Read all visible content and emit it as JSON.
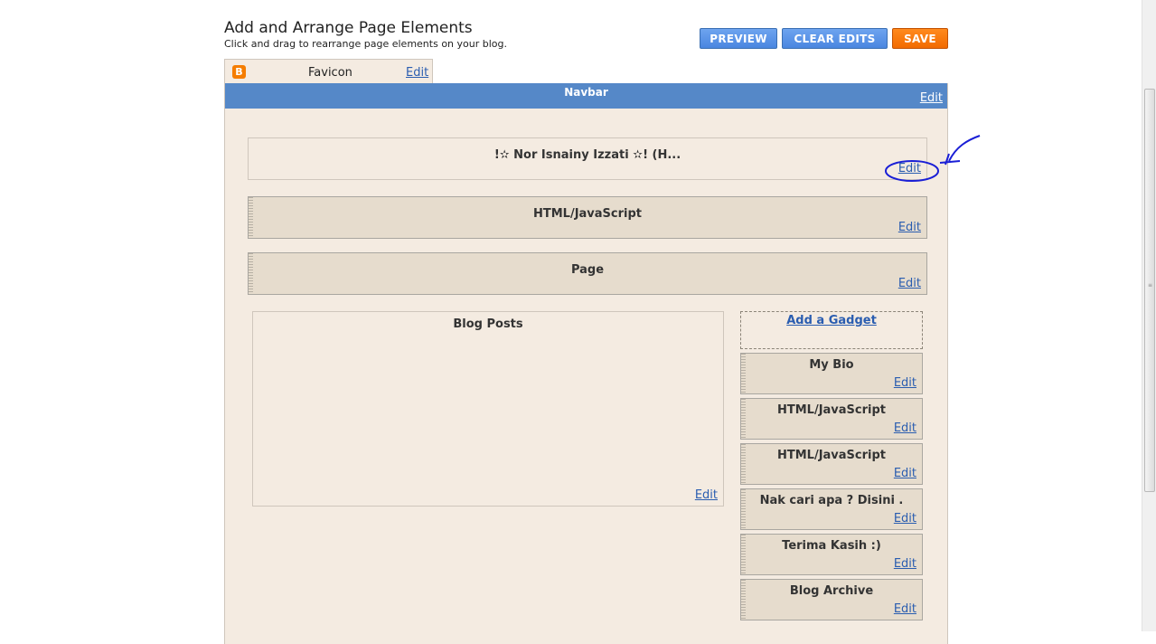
{
  "header": {
    "title": "Add and Arrange Page Elements",
    "subtitle": "Click and drag to rearrange page elements on your blog."
  },
  "toolbar": {
    "preview_label": "PREVIEW",
    "clear_label": "CLEAR EDITS",
    "save_label": "SAVE"
  },
  "favicon": {
    "label": "Favicon",
    "edit": "Edit"
  },
  "navbar": {
    "title": "Navbar",
    "edit": "Edit"
  },
  "header_widget": {
    "title": "!✫ Nor Isnainy Izzati ✫! (H...",
    "edit": "Edit"
  },
  "top_widgets": [
    {
      "title": "HTML/JavaScript",
      "edit": "Edit"
    },
    {
      "title": "Page",
      "edit": "Edit"
    }
  ],
  "main": {
    "title": "Blog Posts",
    "edit": "Edit"
  },
  "sidebar": {
    "add_gadget": "Add a Gadget",
    "items": [
      {
        "title": "My Bio",
        "edit": "Edit"
      },
      {
        "title": "HTML/JavaScript",
        "edit": "Edit"
      },
      {
        "title": "HTML/JavaScript",
        "edit": "Edit"
      },
      {
        "title": "Nak cari apa ? Disini .",
        "edit": "Edit"
      },
      {
        "title": "Terima Kasih :)",
        "edit": "Edit"
      },
      {
        "title": "Blog Archive",
        "edit": "Edit"
      }
    ]
  },
  "colors": {
    "navbar": "#5588c8",
    "canvas": "#f4ebe1",
    "widget": "#e6dccd",
    "button_blue": "#4a86e0",
    "button_orange": "#f26b00",
    "link": "#2a5db0",
    "annotation": "#1a1fd6"
  }
}
